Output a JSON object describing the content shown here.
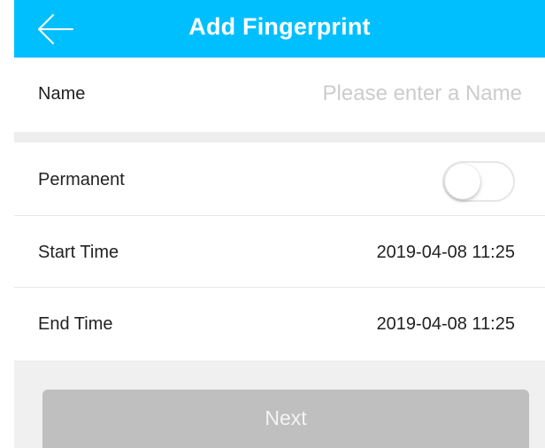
{
  "header": {
    "title": "Add Fingerprint",
    "back_icon": "arrow-left-icon",
    "background_color": "#00bfff"
  },
  "form": {
    "name": {
      "label": "Name",
      "value": "",
      "placeholder": "Please enter a Name"
    },
    "permanent": {
      "label": "Permanent",
      "enabled": false
    },
    "start_time": {
      "label": "Start Time",
      "value": "2019-04-08 11:25"
    },
    "end_time": {
      "label": "End Time",
      "value": "2019-04-08 11:25"
    }
  },
  "footer": {
    "next_label": "Next",
    "next_disabled": true
  }
}
